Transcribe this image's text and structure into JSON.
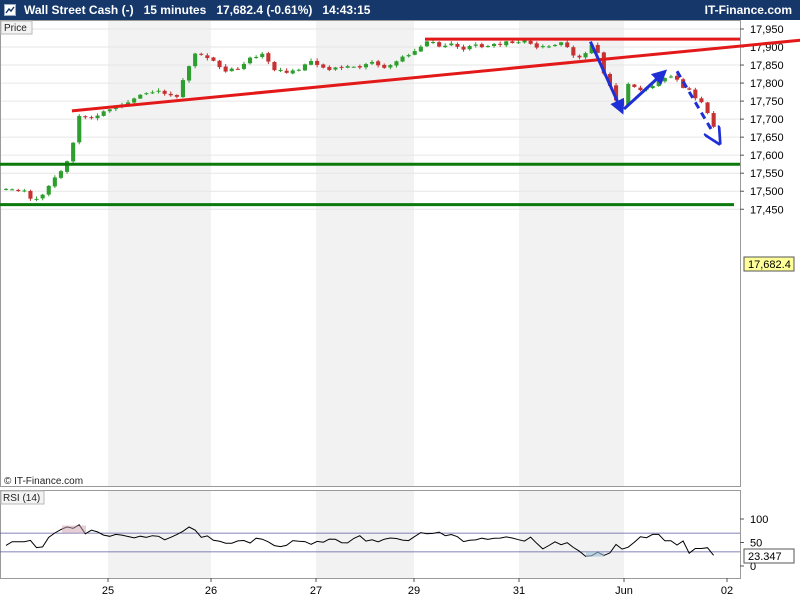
{
  "header": {
    "instrument": "Wall Street Cash (-)",
    "timeframe": "15 minutes",
    "last": "17,682.4 (-0.61%)",
    "time": "14:43:15",
    "brand": "IT-Finance.com"
  },
  "panel_label": "Price",
  "watermark": "© IT-Finance.com",
  "price_tag": "17,682.4",
  "rsi_label": "RSI (14)",
  "rsi_tag": "23.347",
  "colors": {
    "header_bg": "#15376a",
    "bull": "#2e9e2e",
    "bear": "#c43232",
    "trendline": "#e31919",
    "support": "#0b7a0b",
    "arrow": "#1f2fd6",
    "tag_bg": "#ffff99"
  },
  "chart_data": [
    {
      "type": "candlestick",
      "categories": [
        "25",
        "26",
        "27",
        "29",
        "31",
        "Jun",
        "02"
      ],
      "ylim": [
        17460,
        17960
      ],
      "yticks": [
        "17,950",
        "17,900",
        "17,850",
        "17,800",
        "17,750",
        "17,700",
        "17,650",
        "17,600",
        "17,550",
        "17,500",
        "17,450"
      ],
      "path": [
        [
          0,
          17505
        ],
        [
          3,
          17505
        ],
        [
          4.5,
          17470
        ],
        [
          6,
          17490
        ],
        [
          7.5,
          17530
        ],
        [
          9,
          17555
        ],
        [
          10.5,
          17600
        ],
        [
          12,
          17710
        ],
        [
          14,
          17705
        ],
        [
          16,
          17720
        ],
        [
          18,
          17735
        ],
        [
          20,
          17750
        ],
        [
          22,
          17765
        ],
        [
          25,
          17780
        ],
        [
          28,
          17760
        ],
        [
          30,
          17850
        ],
        [
          31,
          17880
        ],
        [
          33,
          17870
        ],
        [
          36,
          17835
        ],
        [
          38,
          17840
        ],
        [
          40,
          17870
        ],
        [
          42,
          17880
        ],
        [
          44,
          17835
        ],
        [
          46,
          17830
        ],
        [
          48,
          17840
        ],
        [
          50,
          17860
        ],
        [
          52,
          17840
        ],
        [
          54,
          17840
        ],
        [
          56,
          17850
        ],
        [
          58,
          17845
        ],
        [
          60,
          17860
        ],
        [
          62,
          17845
        ],
        [
          64,
          17860
        ],
        [
          66,
          17880
        ],
        [
          68,
          17900
        ],
        [
          69,
          17915
        ],
        [
          71,
          17905
        ],
        [
          73,
          17910
        ],
        [
          75,
          17895
        ],
        [
          77,
          17905
        ],
        [
          79,
          17900
        ],
        [
          81,
          17910
        ],
        [
          83,
          17915
        ],
        [
          85,
          17915
        ],
        [
          87,
          17900
        ],
        [
          89,
          17905
        ],
        [
          91,
          17910
        ],
        [
          92,
          17900
        ],
        [
          93,
          17880
        ],
        [
          94,
          17870
        ],
        [
          95,
          17885
        ],
        [
          96,
          17905
        ],
        [
          97,
          17880
        ],
        [
          98,
          17830
        ],
        [
          99,
          17790
        ],
        [
          100,
          17750
        ],
        [
          101,
          17735
        ],
        [
          102,
          17800
        ],
        [
          103,
          17790
        ],
        [
          104,
          17780
        ],
        [
          106,
          17790
        ],
        [
          107,
          17805
        ],
        [
          108,
          17815
        ],
        [
          109,
          17820
        ],
        [
          110,
          17810
        ],
        [
          111,
          17790
        ],
        [
          112,
          17780
        ],
        [
          113,
          17760
        ],
        [
          114,
          17745
        ],
        [
          115,
          17720
        ],
        [
          116,
          17682
        ]
      ],
      "annotations": {
        "resistance": 17922,
        "support_1": 17575,
        "support_2": 17463,
        "trendline": [
          [
            11.3,
            17723
          ],
          [
            132,
            17921
          ]
        ],
        "arrows": [
          [
            [
              96.3,
              17915
            ],
            [
              101.5,
              17720
            ]
          ],
          [
            [
              101.8,
              17728
            ],
            [
              108.5,
              17832
            ]
          ]
        ],
        "projection": [
          [
            110.5,
            17833
          ],
          [
            117.3,
            17637
          ]
        ]
      }
    },
    {
      "type": "line",
      "title": "RSI (14)",
      "ylim": [
        0,
        100
      ],
      "yticks": [
        "100",
        "50",
        "0"
      ],
      "levels": [
        30,
        70
      ],
      "path": [
        [
          0,
          48
        ],
        [
          2,
          50
        ],
        [
          4,
          52
        ],
        [
          5,
          35
        ],
        [
          6,
          40
        ],
        [
          7,
          65
        ],
        [
          8,
          75
        ],
        [
          10,
          80
        ],
        [
          12,
          88
        ],
        [
          13,
          70
        ],
        [
          14,
          72
        ],
        [
          16,
          66
        ],
        [
          18,
          68
        ],
        [
          20,
          60
        ],
        [
          22,
          68
        ],
        [
          24,
          62
        ],
        [
          26,
          58
        ],
        [
          28,
          70
        ],
        [
          30,
          78
        ],
        [
          32,
          65
        ],
        [
          34,
          55
        ],
        [
          36,
          46
        ],
        [
          38,
          55
        ],
        [
          40,
          52
        ],
        [
          42,
          62
        ],
        [
          44,
          42
        ],
        [
          46,
          45
        ],
        [
          48,
          55
        ],
        [
          50,
          50
        ],
        [
          52,
          55
        ],
        [
          54,
          58
        ],
        [
          56,
          50
        ],
        [
          58,
          62
        ],
        [
          60,
          52
        ],
        [
          62,
          56
        ],
        [
          64,
          60
        ],
        [
          66,
          55
        ],
        [
          68,
          70
        ],
        [
          70,
          72
        ],
        [
          72,
          66
        ],
        [
          74,
          60
        ],
        [
          76,
          52
        ],
        [
          78,
          62
        ],
        [
          80,
          56
        ],
        [
          82,
          64
        ],
        [
          84,
          55
        ],
        [
          86,
          60
        ],
        [
          88,
          40
        ],
        [
          90,
          52
        ],
        [
          92,
          48
        ],
        [
          94,
          30
        ],
        [
          95,
          22
        ],
        [
          96,
          20
        ],
        [
          97,
          28
        ],
        [
          98,
          22
        ],
        [
          99,
          26
        ],
        [
          100,
          50
        ],
        [
          101,
          32
        ],
        [
          102,
          40
        ],
        [
          104,
          58
        ],
        [
          106,
          66
        ],
        [
          107,
          72
        ],
        [
          108,
          56
        ],
        [
          109,
          50
        ],
        [
          110,
          42
        ],
        [
          111,
          52
        ],
        [
          112,
          30
        ],
        [
          113,
          38
        ],
        [
          114,
          33
        ],
        [
          115,
          36
        ],
        [
          116,
          23.347
        ]
      ]
    }
  ]
}
